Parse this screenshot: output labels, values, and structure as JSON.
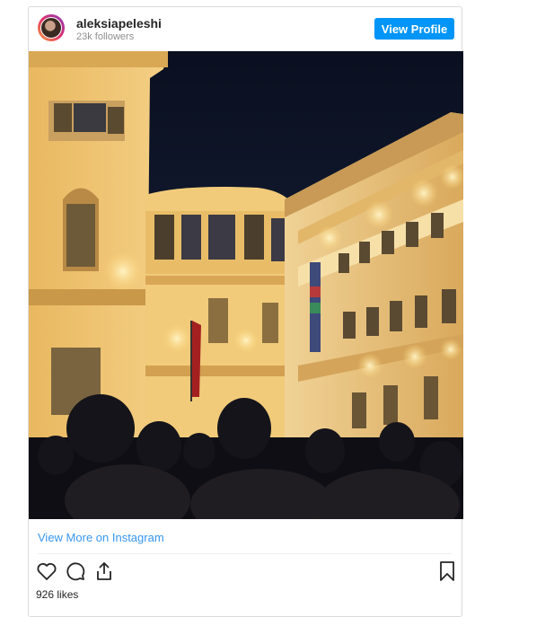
{
  "profile": {
    "username": "aleksiapeleshi",
    "followers": "23k followers",
    "view_profile_label": "View Profile"
  },
  "post": {
    "image_icon": "night-crowd-photo",
    "view_more_label": "View More on Instagram",
    "likes": "926 likes"
  },
  "actions": {
    "like_icon": "heart-icon",
    "comment_icon": "comment-icon",
    "share_icon": "share-icon",
    "save_icon": "bookmark-icon"
  },
  "colors": {
    "button_blue": "#0095f6",
    "link_blue": "#3897f0",
    "border": "#dbdbdb",
    "text": "#262626",
    "muted": "#8e8e8e"
  }
}
